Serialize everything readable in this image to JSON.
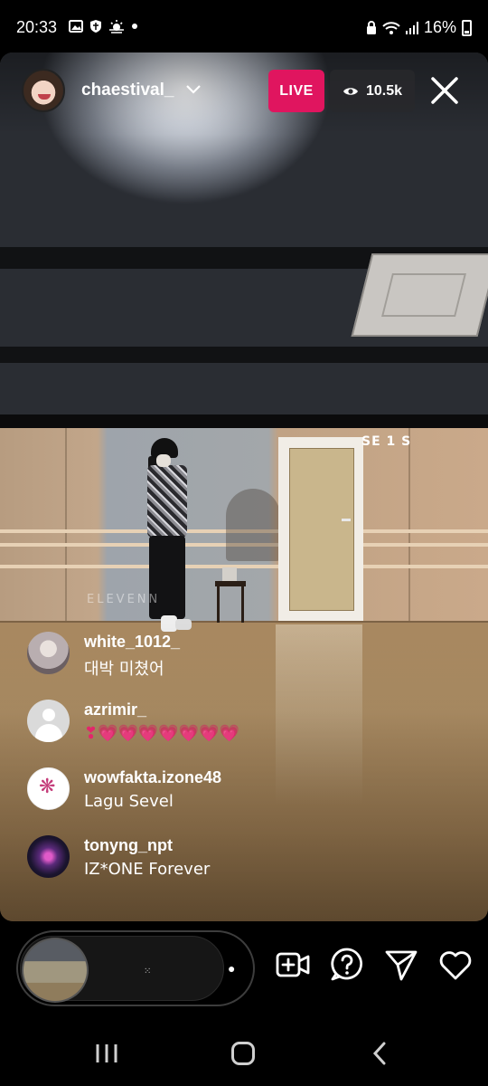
{
  "status_bar": {
    "time": "20:33",
    "battery": "16%",
    "left_icons": [
      "gallery-icon",
      "shield-icon",
      "weather-icon",
      "dot"
    ],
    "right_icons": [
      "lock-icon",
      "wifi-icon",
      "signal-icon",
      "battery-icon"
    ]
  },
  "live": {
    "host_username": "chaestival_",
    "live_label": "LIVE",
    "viewer_count": "10.5k",
    "video_sign": "SE 1 S",
    "video_watermark": "ELEVENN"
  },
  "comments": [
    {
      "username": "white_1012_",
      "text": "대박 미쳤어"
    },
    {
      "username": "azrimir_",
      "text": "❣💗💗💗💗💗💗💗"
    },
    {
      "username": "wowfakta.izone48",
      "text": "Lagu Sevel"
    },
    {
      "username": "tonyng_npt",
      "text": "IZ*ONE Forever"
    }
  ],
  "bottom_actions": {
    "icons": [
      "add-video-icon",
      "question-icon",
      "send-icon",
      "heart-icon"
    ]
  },
  "colors": {
    "live_badge": "#e0155f",
    "background": "#000000"
  }
}
